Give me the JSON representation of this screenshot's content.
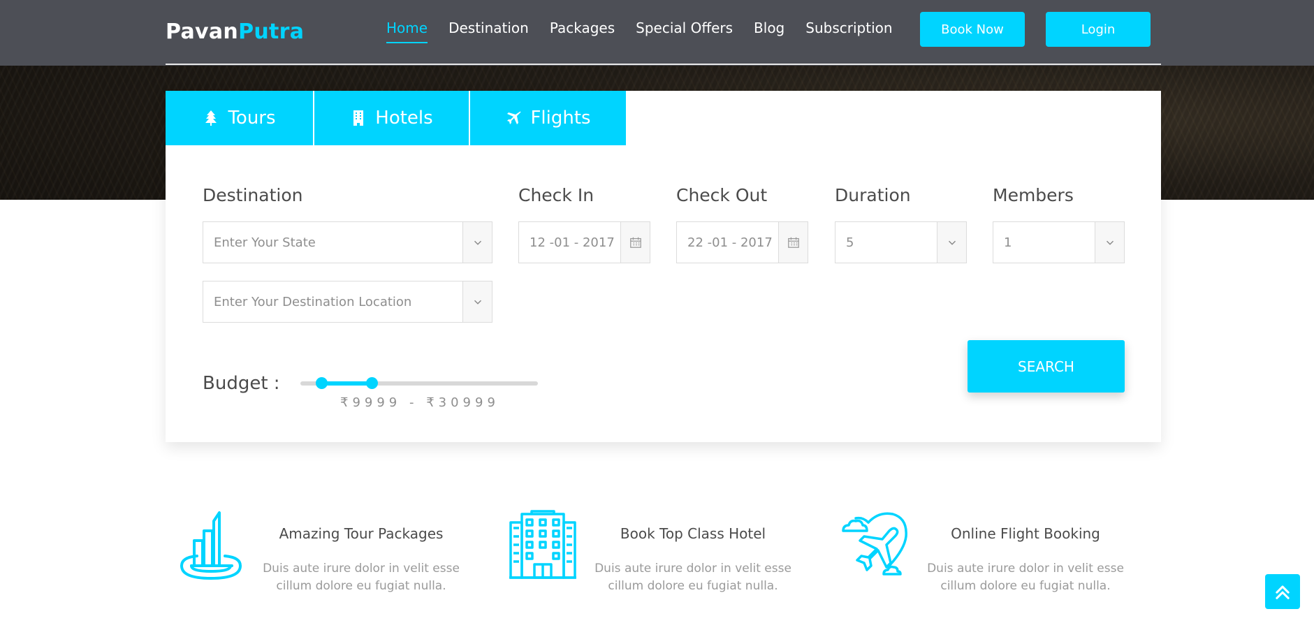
{
  "brand": {
    "name_part1": "Pavan",
    "name_part2": "Putra"
  },
  "nav": {
    "items": [
      {
        "label": "Home",
        "active": true
      },
      {
        "label": "Destination"
      },
      {
        "label": "Packages"
      },
      {
        "label": "Special Offers"
      },
      {
        "label": "Blog"
      },
      {
        "label": "Subscription"
      }
    ],
    "book_now_label": "Book Now",
    "login_label": "Login"
  },
  "search": {
    "tabs": [
      {
        "label": "Tours",
        "icon": "tree-icon"
      },
      {
        "label": "Hotels",
        "icon": "building-icon"
      },
      {
        "label": "Flights",
        "icon": "plane-icon"
      }
    ],
    "destination_label": "Destination",
    "state_placeholder": "Enter Your State",
    "location_placeholder": "Enter Your Destination Location",
    "check_in_label": "Check In",
    "check_in_value": "12 -01 - 2017",
    "check_out_label": "Check Out",
    "check_out_value": "22 -01 - 2017",
    "duration_label": "Duration",
    "duration_value": "5",
    "members_label": "Members",
    "members_value": "1",
    "budget_label": "Budget :",
    "budget_range_text": "₹9999 - ₹30999",
    "budget_min_fraction": 0.09,
    "budget_max_fraction": 0.3,
    "search_label": "SEARCH"
  },
  "features": [
    {
      "title": "Amazing Tour Packages",
      "desc_line1": "Duis aute irure dolor in velit esse",
      "desc_line2": "cillum dolore eu fugiat nulla.",
      "icon": "tour-package-icon"
    },
    {
      "title": "Book Top Class Hotel",
      "desc_line1": "Duis aute irure dolor in velit esse",
      "desc_line2": "cillum dolore eu fugiat nulla.",
      "icon": "hotel-building-icon"
    },
    {
      "title": "Online Flight Booking",
      "desc_line1": "Duis aute irure dolor in velit esse",
      "desc_line2": "cillum dolore eu fugiat nulla.",
      "icon": "flight-booking-icon"
    }
  ],
  "colors": {
    "accent": "#00d4ff",
    "header_bg": "#4d4f56",
    "text_dark": "#4b4b4b",
    "text_muted": "#9a9a9a"
  }
}
